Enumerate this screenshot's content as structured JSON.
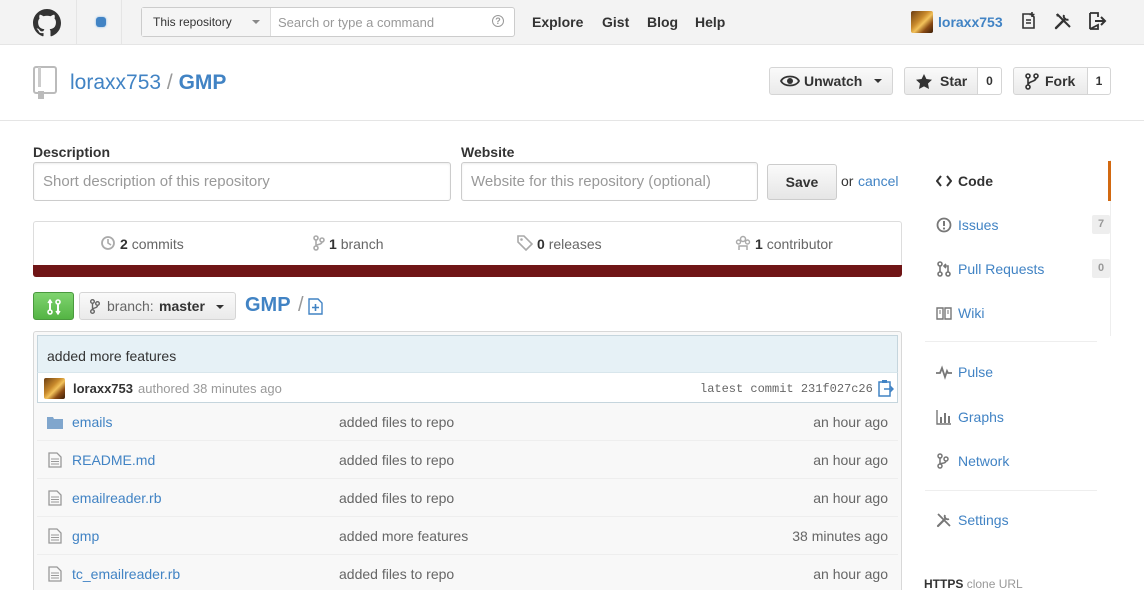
{
  "header": {
    "search_scope": "This repository",
    "search_placeholder": "Search or type a command",
    "nav": [
      "Explore",
      "Gist",
      "Blog",
      "Help"
    ],
    "username": "loraxx753"
  },
  "repo": {
    "owner": "loraxx753",
    "separator": "/",
    "name": "GMP",
    "unwatch_label": "Unwatch",
    "star_label": "Star",
    "star_count": "0",
    "fork_label": "Fork",
    "fork_count": "1"
  },
  "edit": {
    "description_label": "Description",
    "description_placeholder": "Short description of this repository",
    "website_label": "Website",
    "website_placeholder": "Website for this repository (optional)",
    "save_label": "Save",
    "or_text": "or",
    "cancel_label": "cancel"
  },
  "stats": {
    "commits_count": "2",
    "commits_label": "commits",
    "branch_count": "1",
    "branch_label": "branch",
    "releases_count": "0",
    "releases_label": "releases",
    "contributor_count": "1",
    "contributor_label": "contributor",
    "language_color": "#701516"
  },
  "filenav": {
    "branch_prefix": "branch:",
    "branch_name": "master",
    "path": "GMP",
    "path_sep": "/"
  },
  "commit": {
    "message": "added more features",
    "author": "loraxx753",
    "authored": "authored 38 minutes ago",
    "latest": "latest commit 231f027c26"
  },
  "files": [
    {
      "name": "emails",
      "type": "folder",
      "message": "added files to repo",
      "age": "an hour ago"
    },
    {
      "name": "README.md",
      "type": "file",
      "message": "added files to repo",
      "age": "an hour ago"
    },
    {
      "name": "emailreader.rb",
      "type": "file",
      "message": "added files to repo",
      "age": "an hour ago"
    },
    {
      "name": "gmp",
      "type": "file",
      "message": "added more features",
      "age": "38 minutes ago"
    },
    {
      "name": "tc_emailreader.rb",
      "type": "file",
      "message": "added files to repo",
      "age": "an hour ago"
    }
  ],
  "sidebar": {
    "code": "Code",
    "issues": "Issues",
    "issues_count": "7",
    "pulls": "Pull Requests",
    "pulls_count": "0",
    "wiki": "Wiki",
    "pulse": "Pulse",
    "graphs": "Graphs",
    "network": "Network",
    "settings": "Settings",
    "clone_protocol": "HTTPS",
    "clone_label": "clone URL"
  },
  "colors": {
    "link": "#4183c4",
    "accent_active": "#d26911",
    "compare_green": "#6cc644"
  }
}
